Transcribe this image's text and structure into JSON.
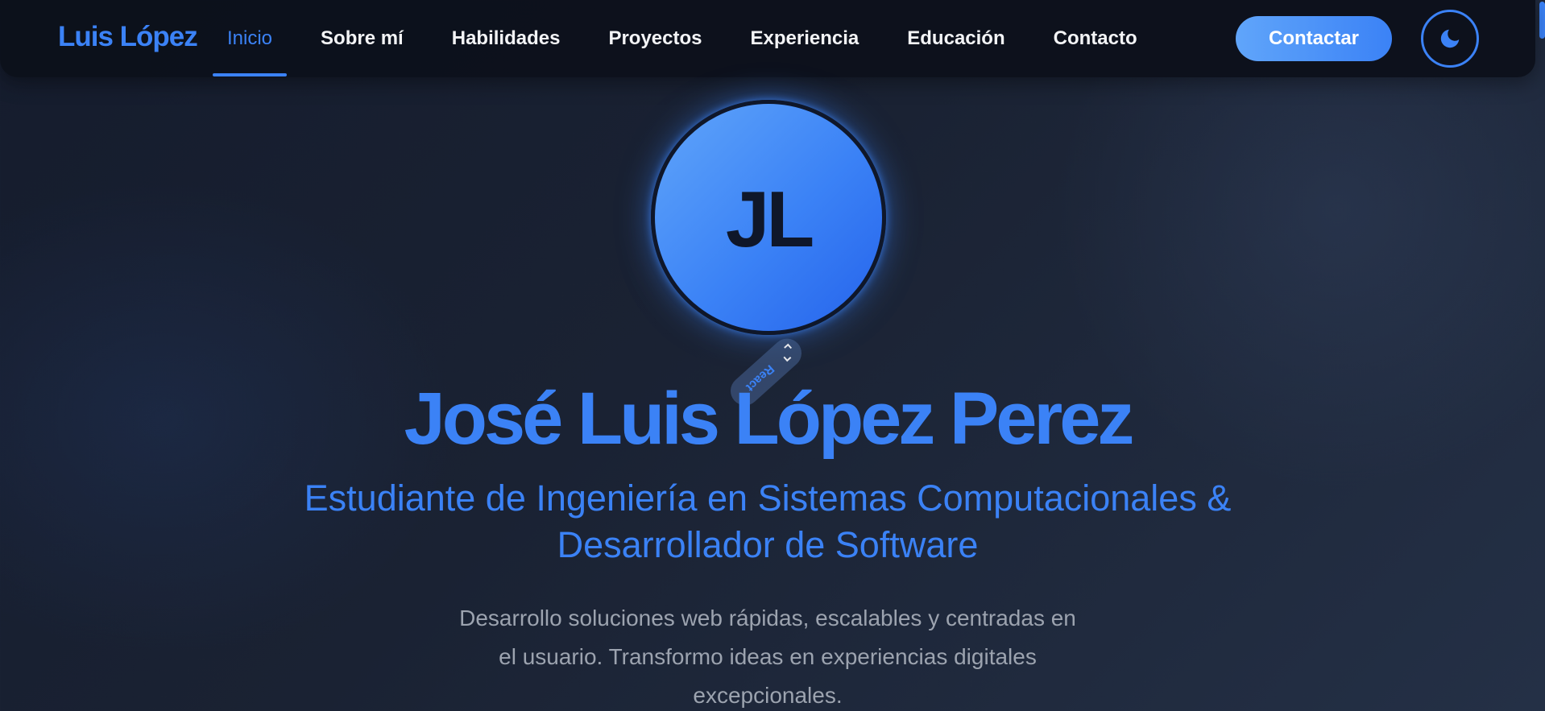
{
  "nav": {
    "logo": "Luis López",
    "links": [
      {
        "label": "Inicio",
        "active": true
      },
      {
        "label": "Sobre mí"
      },
      {
        "label": "Habilidades"
      },
      {
        "label": "Proyectos"
      },
      {
        "label": "Experiencia"
      },
      {
        "label": "Educación"
      },
      {
        "label": "Contacto"
      }
    ],
    "cta_label": "Contactar",
    "theme_icon": "moon-icon"
  },
  "hero": {
    "initials": "JL",
    "tag_label": "React",
    "tag_icon": "expand-icon",
    "name": "José Luis López Perez",
    "subtitle_line1": "Estudiante de Ingeniería en Sistemas Computacionales &",
    "subtitle_line2": "Desarrollador de Software",
    "desc_line1": "Desarrollo soluciones web rápidas, escalables y centradas en",
    "desc_line2": "el usuario. Transformo ideas en experiencias digitales",
    "desc_line3": "excepcionales."
  },
  "colors": {
    "accent": "#3b82f6",
    "background": "#1a2233",
    "muted_text": "#9ca3af"
  }
}
